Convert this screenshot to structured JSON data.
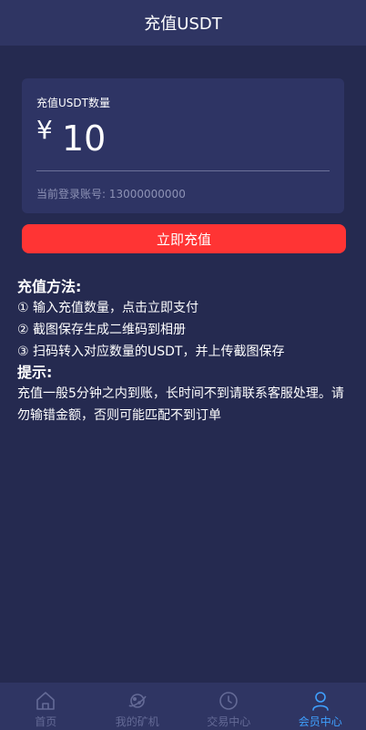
{
  "header": {
    "title": "充值USDT"
  },
  "card": {
    "label": "充值USDT数量",
    "currency_symbol": "¥",
    "amount_value": "10",
    "account_label": "当前登录账号: 13000000000"
  },
  "recharge_button": {
    "label": "立即充值"
  },
  "instructions": {
    "method_heading": "充值方法:",
    "steps": [
      "① 输入充值数量，点击立即支付",
      "② 截图保存生成二维码到相册",
      "③ 扫码转入对应数量的USDT，并上传截图保存"
    ],
    "tips_heading": "提示:",
    "tip_text": "充值一般5分钟之内到账，长时间不到请联系客服处理。请勿输错金额，否则可能匹配不到订单"
  },
  "bottom_nav": {
    "items": [
      {
        "label": "首页",
        "icon": "home-icon",
        "active": false
      },
      {
        "label": "我的矿机",
        "icon": "planet-icon",
        "active": false
      },
      {
        "label": "交易中心",
        "icon": "clock-icon",
        "active": false
      },
      {
        "label": "会员中心",
        "icon": "user-icon",
        "active": true
      }
    ]
  },
  "colors": {
    "background": "#252a50",
    "header": "#2f3563",
    "card": "#2e3464",
    "button": "#ff3434",
    "nav_active": "#3fa0ff",
    "nav_inactive": "#646a96"
  }
}
